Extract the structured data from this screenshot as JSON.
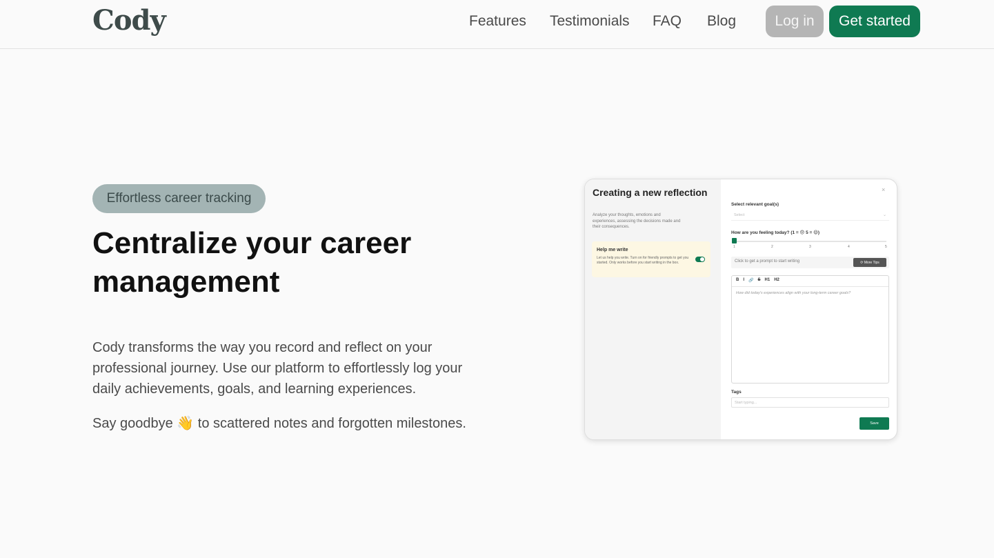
{
  "header": {
    "logo": "Cody",
    "nav": [
      "Features",
      "Testimonials",
      "FAQ",
      "Blog"
    ],
    "login_label": "Log in",
    "get_started_label": "Get started"
  },
  "hero": {
    "badge": "Effortless career tracking",
    "title": "Centralize your career management",
    "description": "Cody transforms the way you record and reflect on your professional journey. Use our platform to effortlessly log your daily achievements, goals, and learning experiences.",
    "goodbye_prefix": "Say goodbye",
    "goodbye_emoji": "👋",
    "goodbye_suffix": "to scattered notes and forgotten milestones."
  },
  "preview": {
    "title": "Creating a new reflection",
    "subtitle": "Analyze your thoughts, emotions and experiences, assessing the decisions made and their consequences.",
    "help_title": "Help me write",
    "help_text": "Let us help you write. Turn on for friendly prompts to get you started. Only works before you start writing in the box.",
    "help_toggle_on": true,
    "close": "×",
    "goals_label": "Select relevant goal(s)",
    "goals_placeholder": "Select",
    "feeling_label": "How are you feeling today? (1 = 😞 5 = 😃)",
    "feeling_ticks": [
      "1",
      "2",
      "3",
      "4",
      "5"
    ],
    "feeling_value": 1,
    "prompt_text": "Click to get a prompt to start writing",
    "more_tips_label": "⟳ More Tips",
    "toolbar": [
      "B",
      "I",
      "🔗",
      "S",
      "H1",
      "H2"
    ],
    "editor_placeholder": "How did today's experiences align with your long-term career goals?",
    "tags_label": "Tags",
    "tags_placeholder": "Start typing...",
    "save_label": "Save"
  }
}
